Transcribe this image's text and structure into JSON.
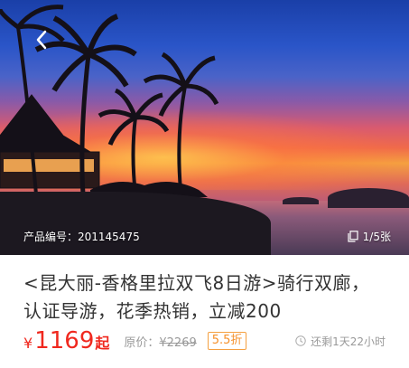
{
  "hero": {
    "product_code_label": "产品编号：201145475",
    "image_count": "1/5张"
  },
  "product": {
    "title": "<昆大丽-香格里拉双飞8日游>骑行双廊，认证导游，花季热销，立减200",
    "currency": "¥",
    "price": "1169",
    "price_suffix": "起",
    "original_price_label": "原价：",
    "original_price": "¥2269",
    "discount": "5.5折",
    "countdown": "还剩1天22小时"
  },
  "colors": {
    "price": "#f0281e",
    "discount": "#f5902a",
    "muted": "#999999",
    "title": "#333333"
  },
  "icons": {
    "back": "chevron-left-icon",
    "gallery": "copy-icon",
    "clock": "clock-icon"
  }
}
